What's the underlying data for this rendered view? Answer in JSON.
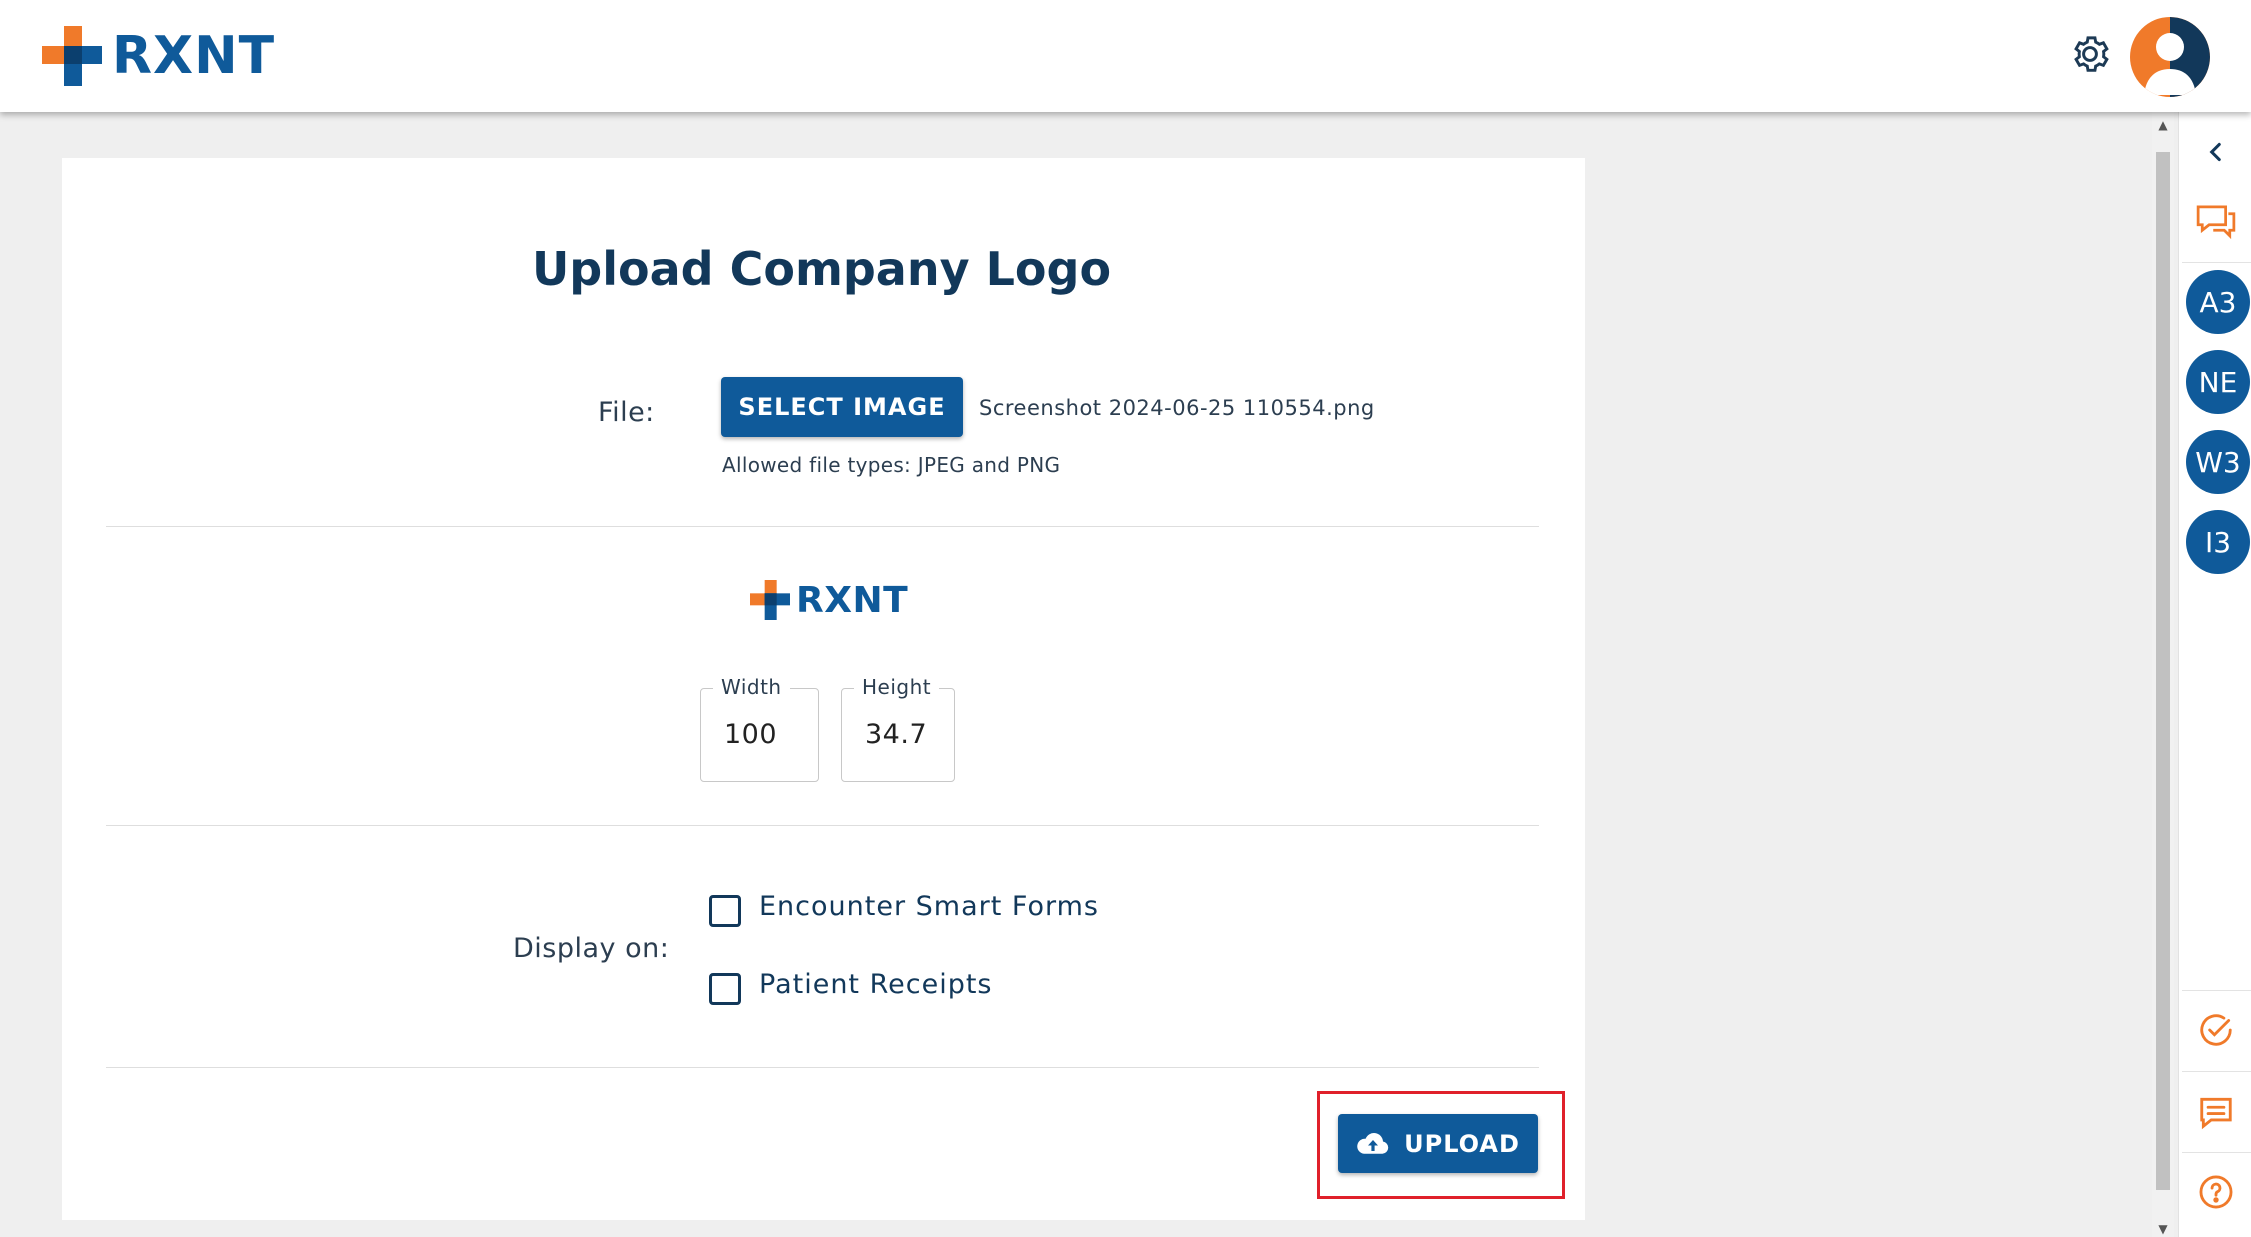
{
  "header": {
    "brand": "RXNT",
    "icons": {
      "settings": "gear-icon",
      "profile": "avatar-icon"
    }
  },
  "colors": {
    "brand_blue": "#0f5a9a",
    "brand_orange": "#f07a2a",
    "title_navy": "#12385a",
    "highlight_red": "#e0202a"
  },
  "rail": {
    "collapse_icon": "chevron-left-icon",
    "chat_icon": "chat-bubbles-icon",
    "bubbles": [
      "A3",
      "NE",
      "W3",
      "I3"
    ],
    "bottom_icons": [
      "check-circle-icon",
      "message-icon",
      "help-circle-icon"
    ]
  },
  "form": {
    "title": "Upload Company Logo",
    "file_label": "File:",
    "select_button": "SELECT IMAGE",
    "file_name": "Screenshot 2024-06-25 110554.png",
    "allowed_types": "Allowed file types: JPEG and PNG",
    "preview_brand": "RXNT",
    "width": {
      "label": "Width",
      "value": "100"
    },
    "height": {
      "label": "Height",
      "value": "34.7"
    },
    "display_label": "Display on:",
    "options": [
      {
        "label": "Encounter Smart Forms",
        "checked": false
      },
      {
        "label": "Patient Receipts",
        "checked": false
      }
    ],
    "upload_button": "UPLOAD",
    "upload_icon": "cloud-upload-icon"
  }
}
